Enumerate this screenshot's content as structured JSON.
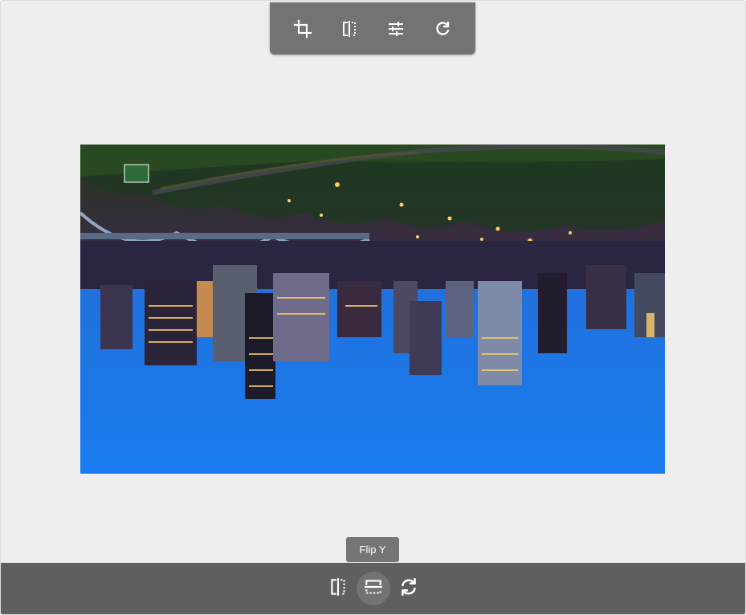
{
  "top_toolbar": {
    "tools": [
      {
        "icon": "crop-icon",
        "name": "crop"
      },
      {
        "icon": "flip-icon",
        "name": "flip"
      },
      {
        "icon": "adjust-icon",
        "name": "adjust"
      },
      {
        "icon": "rotate-icon",
        "name": "rotate"
      }
    ]
  },
  "image": {
    "description_icon": "flipped-city-skyline-photo",
    "colors": {
      "sky": "#1e7de8",
      "water": "#2a1a33",
      "grass": "#3c6a1e"
    }
  },
  "tooltip": {
    "text": "Flip Y"
  },
  "bottom_bar": {
    "buttons": [
      {
        "icon": "flip-x-icon",
        "name": "flip-x",
        "active": false
      },
      {
        "icon": "flip-y-icon",
        "name": "flip-y",
        "active": true
      },
      {
        "icon": "reset-icon",
        "name": "reset",
        "active": false
      }
    ]
  },
  "colors": {
    "editor_bg": "#eeeeee",
    "toolbar_bg": "#737373",
    "bottom_bar_bg": "#5f5f5f",
    "icon": "#ffffff"
  }
}
